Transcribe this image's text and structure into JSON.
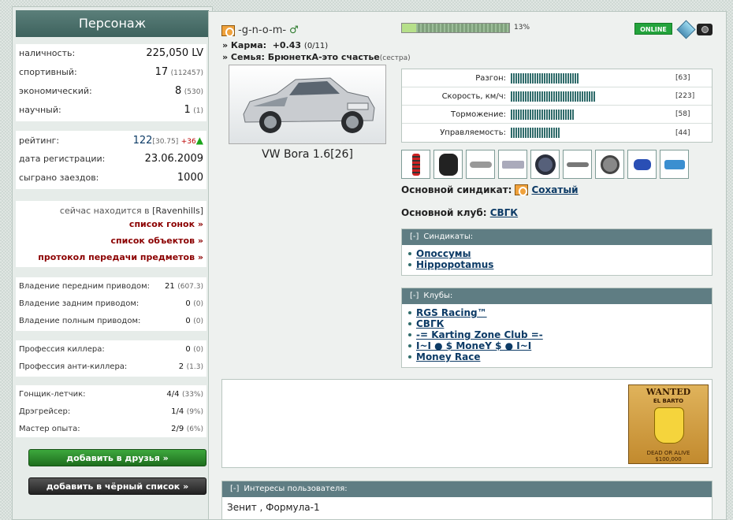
{
  "sidebar": {
    "title": "Персонаж",
    "money": {
      "label": "наличность:",
      "value": "225,050 LV"
    },
    "skills": [
      {
        "label": "спортивный:",
        "value": "17",
        "sub": "(112457)"
      },
      {
        "label": "экономический:",
        "value": "8",
        "sub": "(530)"
      },
      {
        "label": "научный:",
        "value": "1",
        "sub": "(1)"
      }
    ],
    "rating": {
      "label": "рейтинг:",
      "value": "122",
      "sub": "[30.75]",
      "delta": "+36"
    },
    "registration": {
      "label": "дата регистрации:",
      "value": "23.06.2009"
    },
    "races": {
      "label": "сыграно заездов:",
      "value": "1000"
    },
    "location_prefix": "сейчас находится в",
    "location": "[Ravenhills]",
    "links": [
      "список гонок »",
      "список объектов »",
      "протокол передачи предметов »"
    ],
    "drive": [
      {
        "label": "Владение передним приводом:",
        "value": "21",
        "sub": "(607.3)"
      },
      {
        "label": "Владение задним приводом:",
        "value": "0",
        "sub": "(0)"
      },
      {
        "label": "Владение полным приводом:",
        "value": "0",
        "sub": "(0)"
      }
    ],
    "professions": [
      {
        "label": "Профессия киллера:",
        "value": "0",
        "sub": "(0)"
      },
      {
        "label": "Профессия анти-киллера:",
        "value": "2",
        "sub": "(1.3)"
      }
    ],
    "titles": [
      {
        "label": "Гонщик-летчик:",
        "value": "4/4",
        "sub": "(33%)"
      },
      {
        "label": "Дрэгрейсер:",
        "value": "1/4",
        "sub": "(9%)"
      },
      {
        "label": "Мастер опыта:",
        "value": "2/9",
        "sub": "(6%)"
      }
    ],
    "add_friend": "добавить в друзья »",
    "add_blacklist": "добавить в чёрный список »"
  },
  "profile": {
    "nick": "-g-n-o-m-",
    "gender_symbol": "♂",
    "karma_label": "» Карма:",
    "karma_value": "+0.43",
    "karma_sub": "(0/11)",
    "family_label": "» Семья: БрюнеткА-это счастье",
    "family_sub": "(сестра)",
    "car_name": "VW Bora 1.6[26]",
    "exp_percent_text": "13%",
    "exp_fraction": 0.13,
    "online": "ONLINE"
  },
  "stats": [
    {
      "label": "Разгон:",
      "value": "[63]",
      "fraction": 0.42
    },
    {
      "label": "Скорость, км/ч:",
      "value": "[223]",
      "fraction": 0.52
    },
    {
      "label": "Торможение:",
      "value": "[58]",
      "fraction": 0.39
    },
    {
      "label": "Управляемость:",
      "value": "[44]",
      "fraction": 0.3
    }
  ],
  "syndicate_label": "Основной синдикат:",
  "syndicate_name": "Сохатый",
  "club_label": "Основной клуб:",
  "club_name": "СВГК",
  "syndicates_panel": {
    "toggle": "[-]",
    "title": "Синдикаты:",
    "items": [
      "Опоссумы",
      "Hippopotamus"
    ]
  },
  "clubs_panel": {
    "toggle": "[-]",
    "title": "Клубы:",
    "items": [
      "RGS Racing™",
      "СВГК",
      "-= Karting Zone Club =-",
      "I~I ● $ MoneY $ ● I~I",
      "Money Race"
    ]
  },
  "wanted": {
    "line1": "WANTED",
    "line2": "EL BARTO",
    "line3": "DEAD OR ALIVE",
    "line4": "$100,000"
  },
  "interests": {
    "toggle": "[-]",
    "title": "Интересы пользователя:",
    "text": "Зенит , Формула-1"
  },
  "colors": {
    "header": "#3d625d",
    "link": "#0d3b66",
    "accent_red": "#8b0000",
    "online": "#23a33c"
  }
}
